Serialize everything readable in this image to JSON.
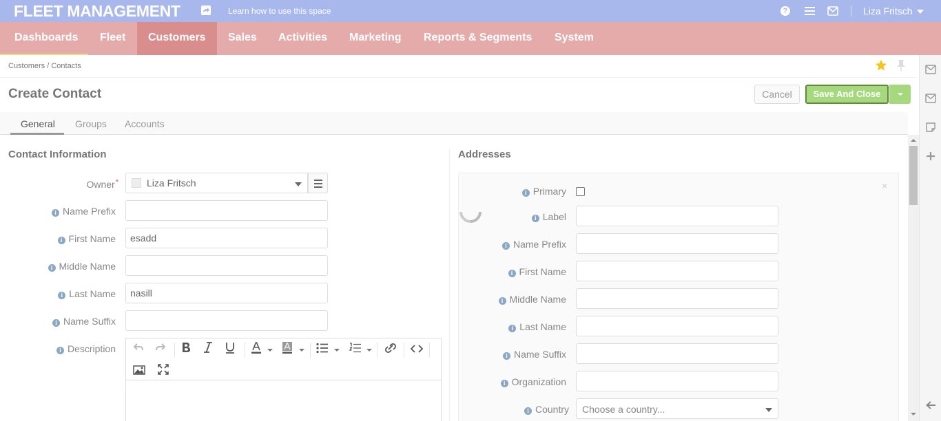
{
  "topbar": {
    "brand": "FLEET MANAGEMENT",
    "learn_link": "Learn how to use this space",
    "help_glyph": "?",
    "user_name": "Liza Fritsch",
    "icons": [
      "share-icon",
      "help-icon",
      "menu-icon",
      "mail-icon",
      "chevron-down-icon"
    ]
  },
  "nav": {
    "items": [
      "Dashboards",
      "Fleet",
      "Customers",
      "Sales",
      "Activities",
      "Marketing",
      "Reports & Segments",
      "System"
    ],
    "active": "Customers"
  },
  "breadcrumb": "Customers / Contacts",
  "page": {
    "title": "Create Contact",
    "cancel_label": "Cancel",
    "save_label": "Save And Close"
  },
  "tabs": [
    "General",
    "Groups",
    "Accounts"
  ],
  "contact_info": {
    "section_title": "Contact Information",
    "owner_label": "Owner",
    "owner_required_mark": "*",
    "owner_value": "Liza Fritsch",
    "name_prefix_label": "Name Prefix",
    "name_prefix_value": "",
    "first_name_label": "First Name",
    "first_name_value": "esadd",
    "middle_name_label": "Middle Name",
    "middle_name_value": "",
    "last_name_label": "Last Name",
    "last_name_value": "nasill",
    "name_suffix_label": "Name Suffix",
    "name_suffix_value": "",
    "description_label": "Description"
  },
  "addresses": {
    "section_title": "Addresses",
    "primary_label": "Primary",
    "label_label": "Label",
    "name_prefix_label": "Name Prefix",
    "first_name_label": "First Name",
    "middle_name_label": "Middle Name",
    "last_name_label": "Last Name",
    "name_suffix_label": "Name Suffix",
    "organization_label": "Organization",
    "country_label": "Country",
    "country_placeholder": "Choose a country...",
    "close_glyph": "×"
  },
  "colors": {
    "topbar": "#a9b8ec",
    "navbar": "#e5abab",
    "nav_active": "#d98d8d",
    "save_button": "#a6d97e",
    "star": "#f5c518"
  }
}
